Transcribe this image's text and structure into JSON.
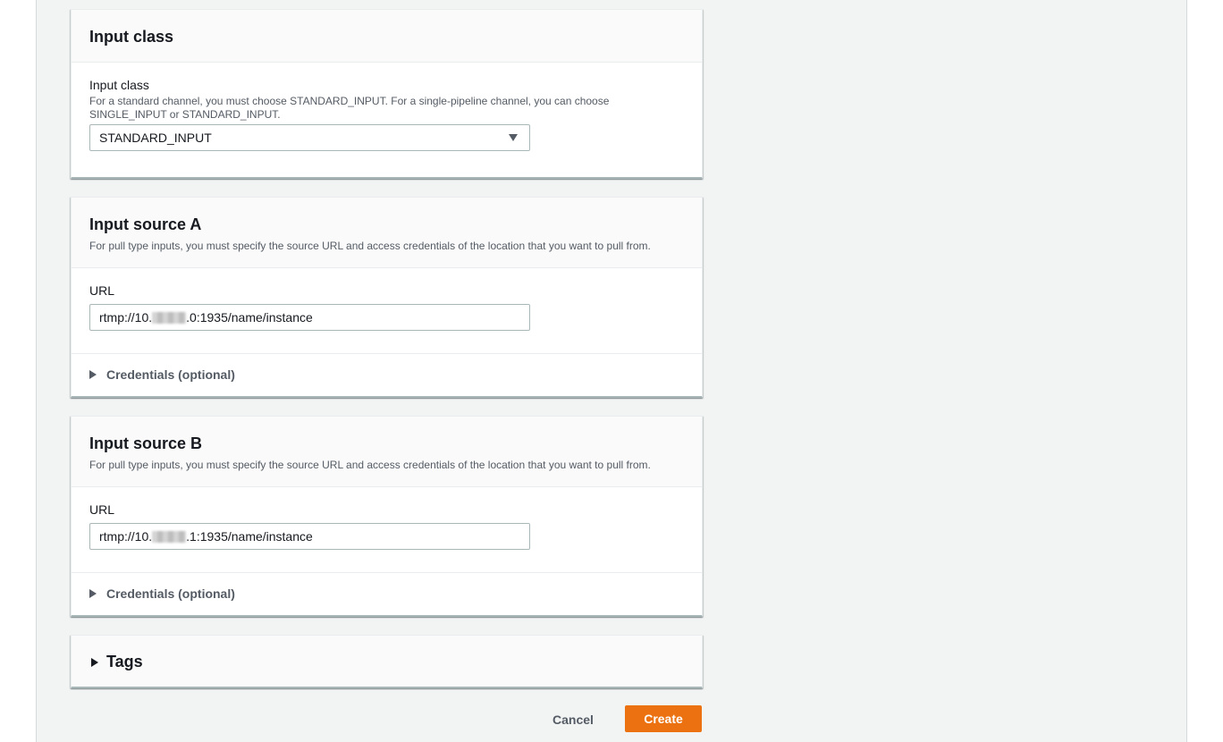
{
  "input_class_panel": {
    "title": "Input class",
    "field_label": "Input class",
    "field_description": "For a standard channel, you must choose STANDARD_INPUT. For a single-pipeline channel, you can choose SINGLE_INPUT or STANDARD_INPUT.",
    "selected_value": "STANDARD_INPUT"
  },
  "input_source_a": {
    "title": "Input source A",
    "description": "For pull type inputs, you must specify the source URL and access credentials of the location that you want to pull from.",
    "url_label": "URL",
    "url_prefix": "rtmp://10.",
    "url_suffix": ".0:1935/name/instance",
    "credentials_label": "Credentials (optional)"
  },
  "input_source_b": {
    "title": "Input source B",
    "description": "For pull type inputs, you must specify the source URL and access credentials of the location that you want to pull from.",
    "url_label": "URL",
    "url_prefix": "rtmp://10.",
    "url_suffix": ".1:1935/name/instance",
    "credentials_label": "Credentials (optional)"
  },
  "tags_panel": {
    "title": "Tags"
  },
  "footer": {
    "cancel_label": "Cancel",
    "create_label": "Create"
  },
  "colors": {
    "primary_button": "#ec7211",
    "page_background": "#f2f3f3"
  }
}
